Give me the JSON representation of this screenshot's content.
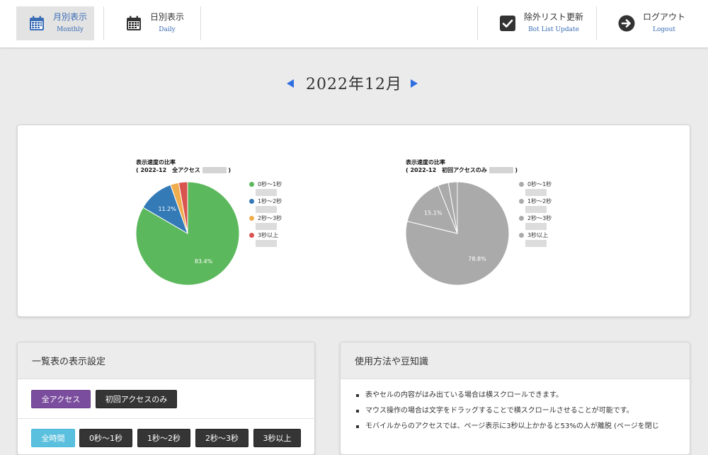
{
  "nav": {
    "monthly": {
      "label": "月別表示",
      "sublabel": "Monthly",
      "icon": "calendar-icon"
    },
    "daily": {
      "label": "日別表示",
      "sublabel": "Daily",
      "icon": "calendar-icon"
    },
    "bot_list": {
      "label": "除外リスト更新",
      "sublabel": "Bot List Update",
      "icon": "checkbox-icon"
    },
    "logout": {
      "label": "ログアウト",
      "sublabel": "Logout",
      "icon": "arrow-right-circle-icon"
    }
  },
  "month_nav": {
    "title": "2022年12月",
    "prev_icon": "triangle-left-icon",
    "next_icon": "triangle-right-icon"
  },
  "chart_data": [
    {
      "type": "pie",
      "title_line1": "表示速度の比率",
      "title_line2": "( 2022-12　全アクセス",
      "title_suffix": ")",
      "categories": [
        "0秒～1秒",
        "1秒～2秒",
        "2秒～3秒",
        "3秒以上"
      ],
      "values": [
        83.4,
        11.2,
        2.6,
        2.8
      ],
      "data_labels": [
        "83.4%",
        "11.2%",
        "",
        ""
      ],
      "colors": [
        "#5cb85c",
        "#337ab7",
        "#f0ad4e",
        "#d9534f"
      ],
      "legend": "right"
    },
    {
      "type": "pie",
      "title_line1": "表示速度の比率",
      "title_line2": "( 2022-12　初回アクセスのみ",
      "title_suffix": ")",
      "categories": [
        "0秒～1秒",
        "1秒～2秒",
        "2秒～3秒",
        "3秒以上"
      ],
      "values": [
        78.8,
        15.1,
        3.3,
        2.8
      ],
      "data_labels": [
        "78.8%",
        "15.1%",
        "",
        ""
      ],
      "colors": [
        "#aaaaaa",
        "#aaaaaa",
        "#aaaaaa",
        "#aaaaaa"
      ],
      "legend": "right"
    }
  ],
  "settings_panel": {
    "title": "一覧表の表示設定",
    "buttons": [
      "全アクセス",
      "初回アクセスのみ"
    ],
    "time_buttons": [
      "全時間",
      "0秒～1秒",
      "1秒～2秒",
      "2秒～3秒",
      "3秒以上"
    ]
  },
  "tips_panel": {
    "title": "使用方法や豆知識",
    "items": [
      "表やセルの内容がはみ出ている場合は横スクロールできます。",
      "マウス操作の場合は文字をドラッグすることで横スクロールさせることが可能です。",
      "モバイルからのアクセスでは、ページ表示に3秒以上かかると53%の人が離脱 (ページを閉じ"
    ]
  },
  "colors": {
    "accent": "#2f6fe0",
    "active_nav_bg": "#e3e3e3",
    "purple": "#7b4d9e",
    "dark": "#353535",
    "cyan": "#5bc0de"
  }
}
